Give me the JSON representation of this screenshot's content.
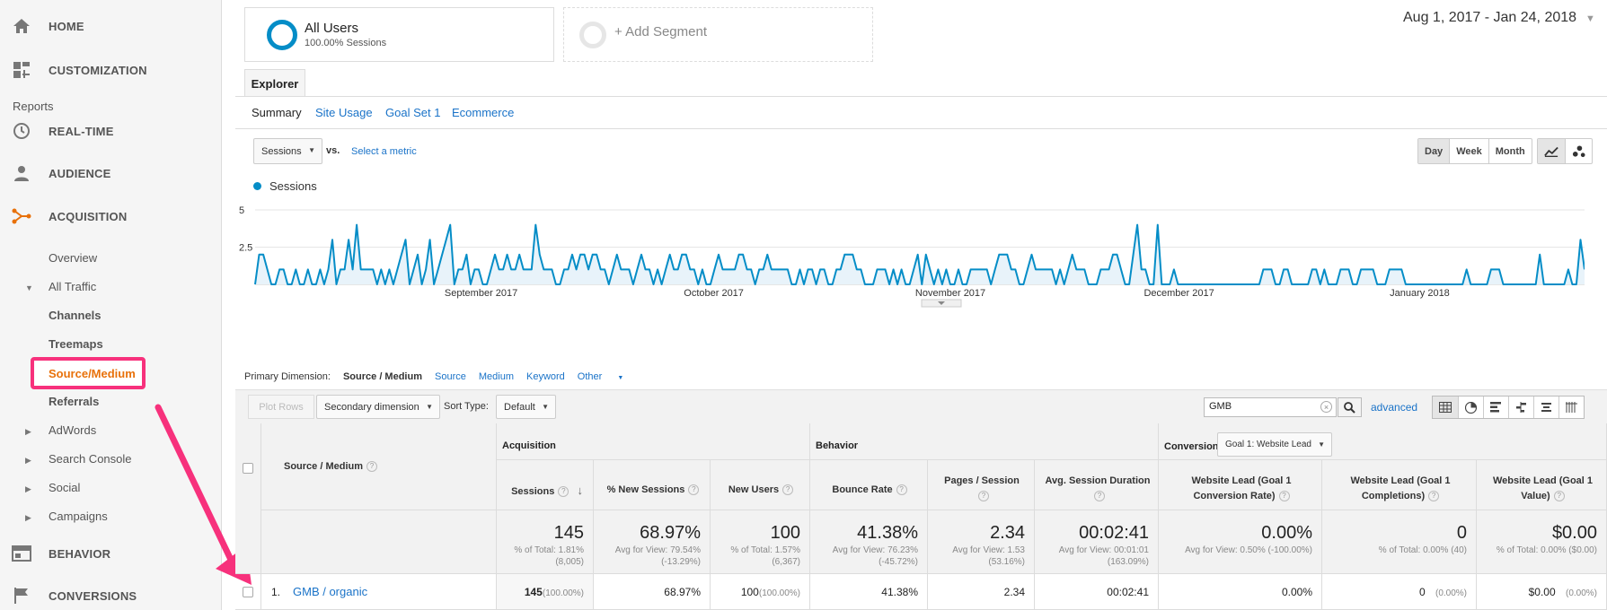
{
  "sidebar": {
    "home": "HOME",
    "customization": "CUSTOMIZATION",
    "reports": "Reports",
    "realtime": "REAL-TIME",
    "audience": "AUDIENCE",
    "acquisition": "ACQUISITION",
    "overview": "Overview",
    "all_traffic": "All Traffic",
    "channels": "Channels",
    "treemaps": "Treemaps",
    "source_medium": "Source/Medium",
    "referrals": "Referrals",
    "adwords": "AdWords",
    "search_console": "Search Console",
    "social": "Social",
    "campaigns": "Campaigns",
    "behavior": "BEHAVIOR",
    "conversions": "CONVERSIONS",
    "accent_color": "#e8710a",
    "highlight_color": "#f7317c"
  },
  "segments": {
    "all_users": "All Users",
    "all_users_sub": "100.00% Sessions",
    "add_segment": "+ Add Segment"
  },
  "date_range": "Aug 1, 2017 - Jan 24, 2018",
  "tabs": {
    "explorer": "Explorer",
    "summary": "Summary",
    "site_usage": "Site Usage",
    "goal_set_1": "Goal Set 1",
    "ecommerce": "Ecommerce"
  },
  "controls": {
    "metric": "Sessions",
    "vs": "vs.",
    "select_metric": "Select a metric",
    "day": "Day",
    "week": "Week",
    "month": "Month"
  },
  "chart_data": {
    "type": "area",
    "series": [
      {
        "name": "Sessions",
        "color": "#058dc7",
        "values": [
          0,
          2,
          2,
          1,
          0,
          0,
          1,
          1,
          0,
          0,
          1,
          0,
          0,
          1,
          0,
          0,
          1,
          0,
          1,
          3,
          0,
          1,
          1,
          3,
          1,
          4,
          1,
          1,
          1,
          1,
          0,
          1,
          0,
          1,
          0,
          1,
          2,
          3,
          0,
          1,
          2,
          0,
          1,
          3,
          0,
          1,
          2,
          3,
          4,
          0,
          1,
          1,
          2,
          0,
          1,
          1,
          0,
          0,
          1,
          2,
          1,
          1,
          2,
          1,
          1,
          2,
          1,
          1,
          1,
          4,
          2,
          1,
          1,
          1,
          0,
          0,
          1,
          1,
          2,
          1,
          2,
          2,
          1,
          2,
          2,
          1,
          1,
          0,
          1,
          2,
          1,
          1,
          1,
          0,
          1,
          2,
          1,
          1,
          0,
          1,
          0,
          1,
          2,
          1,
          1,
          2,
          2,
          1,
          1,
          0,
          1,
          0,
          0,
          1,
          2,
          1,
          1,
          1,
          1,
          2,
          2,
          1,
          1,
          0,
          1,
          1,
          2,
          1,
          1,
          1,
          1,
          1,
          0,
          0,
          1,
          0,
          1,
          1,
          0,
          1,
          1,
          0,
          0,
          1,
          1,
          2,
          2,
          2,
          1,
          1,
          0,
          0,
          0,
          1,
          1,
          1,
          0,
          1,
          0,
          1,
          0,
          0,
          1,
          2,
          0,
          2,
          1,
          0,
          1,
          0,
          1,
          0,
          0,
          1,
          0,
          0,
          1,
          1,
          1,
          1,
          1,
          0,
          1,
          2,
          2,
          2,
          1,
          1,
          0,
          0,
          1,
          2,
          1,
          1,
          1,
          1,
          1,
          0,
          1,
          0,
          1,
          2,
          1,
          1,
          1,
          0,
          0,
          0,
          1,
          1,
          1,
          2,
          2,
          1,
          0,
          0,
          2,
          4,
          1,
          1,
          0,
          0,
          4,
          0,
          0,
          0,
          1,
          0,
          0,
          0,
          0,
          0,
          0,
          0,
          0,
          0,
          0,
          0,
          0,
          0,
          0,
          0,
          0,
          0,
          0,
          0,
          0,
          0,
          1,
          1,
          1,
          0,
          0,
          1,
          1,
          0,
          0,
          0,
          0,
          0,
          1,
          1,
          0,
          1,
          0,
          0,
          0,
          1,
          1,
          1,
          0,
          0,
          1,
          1,
          1,
          1,
          0,
          0,
          0,
          1,
          1,
          1,
          1,
          0,
          0,
          0,
          0,
          0,
          0,
          0,
          0,
          0,
          0,
          0,
          0,
          0,
          0,
          0,
          1,
          0,
          0,
          0,
          0,
          0,
          1,
          1,
          1,
          0,
          0,
          0,
          0,
          0,
          0,
          0,
          0,
          0,
          2,
          0,
          0,
          0,
          0,
          0,
          0,
          1,
          0,
          0,
          3,
          1
        ]
      }
    ],
    "x_tick_labels": [
      "September 2017",
      "October 2017",
      "November 2017",
      "December 2017",
      "January 2018"
    ],
    "y_tick_labels": [
      "5",
      "2.5"
    ],
    "ylim": [
      0,
      5
    ],
    "grid": true
  },
  "primary_dimension": {
    "label": "Primary Dimension:",
    "current": "Source / Medium",
    "options": [
      "Source",
      "Medium",
      "Keyword",
      "Other"
    ]
  },
  "toolbar": {
    "plot_rows": "Plot Rows",
    "secondary_dimension": "Secondary dimension",
    "sort_type_label": "Sort Type:",
    "sort_type": "Default",
    "search_value": "GMB",
    "advanced": "advanced"
  },
  "table": {
    "dim_header": "Source / Medium",
    "group_acquisition": "Acquisition",
    "group_behavior": "Behavior",
    "group_conversions": "Conversions",
    "goal_select": "Goal 1: Website Lead",
    "columns": [
      "Sessions",
      "% New Sessions",
      "New Users",
      "Bounce Rate",
      "Pages / Session",
      "Avg. Session Duration",
      "Website Lead (Goal 1 Conversion Rate)",
      "Website Lead (Goal 1 Completions)",
      "Website Lead (Goal 1 Value)"
    ],
    "totals": [
      {
        "value": "145",
        "sub": "% of Total: 1.81% (8,005)"
      },
      {
        "value": "68.97%",
        "sub": "Avg for View: 79.54% (-13.29%)"
      },
      {
        "value": "100",
        "sub": "% of Total: 1.57% (6,367)"
      },
      {
        "value": "41.38%",
        "sub": "Avg for View: 76.23% (-45.72%)"
      },
      {
        "value": "2.34",
        "sub": "Avg for View: 1.53 (53.16%)"
      },
      {
        "value": "00:02:41",
        "sub": "Avg for View: 00:01:01 (163.09%)"
      },
      {
        "value": "0.00%",
        "sub": "Avg for View: 0.50% (-100.00%)"
      },
      {
        "value": "0",
        "sub": "% of Total: 0.00% (40)"
      },
      {
        "value": "$0.00",
        "sub": "% of Total: 0.00% ($0.00)"
      }
    ],
    "rows": [
      {
        "index": "1.",
        "dimension": "GMB / organic",
        "sessions": "145",
        "sessions_pct": "(100.00%)",
        "new_sessions": "68.97%",
        "new_users": "100",
        "new_users_pct": "(100.00%)",
        "bounce_rate": "41.38%",
        "pages_session": "2.34",
        "avg_duration": "00:02:41",
        "conv_rate": "0.00%",
        "completions": "0",
        "completions_pct": "(0.00%)",
        "value": "$0.00",
        "value_pct": "(0.00%)"
      }
    ]
  }
}
